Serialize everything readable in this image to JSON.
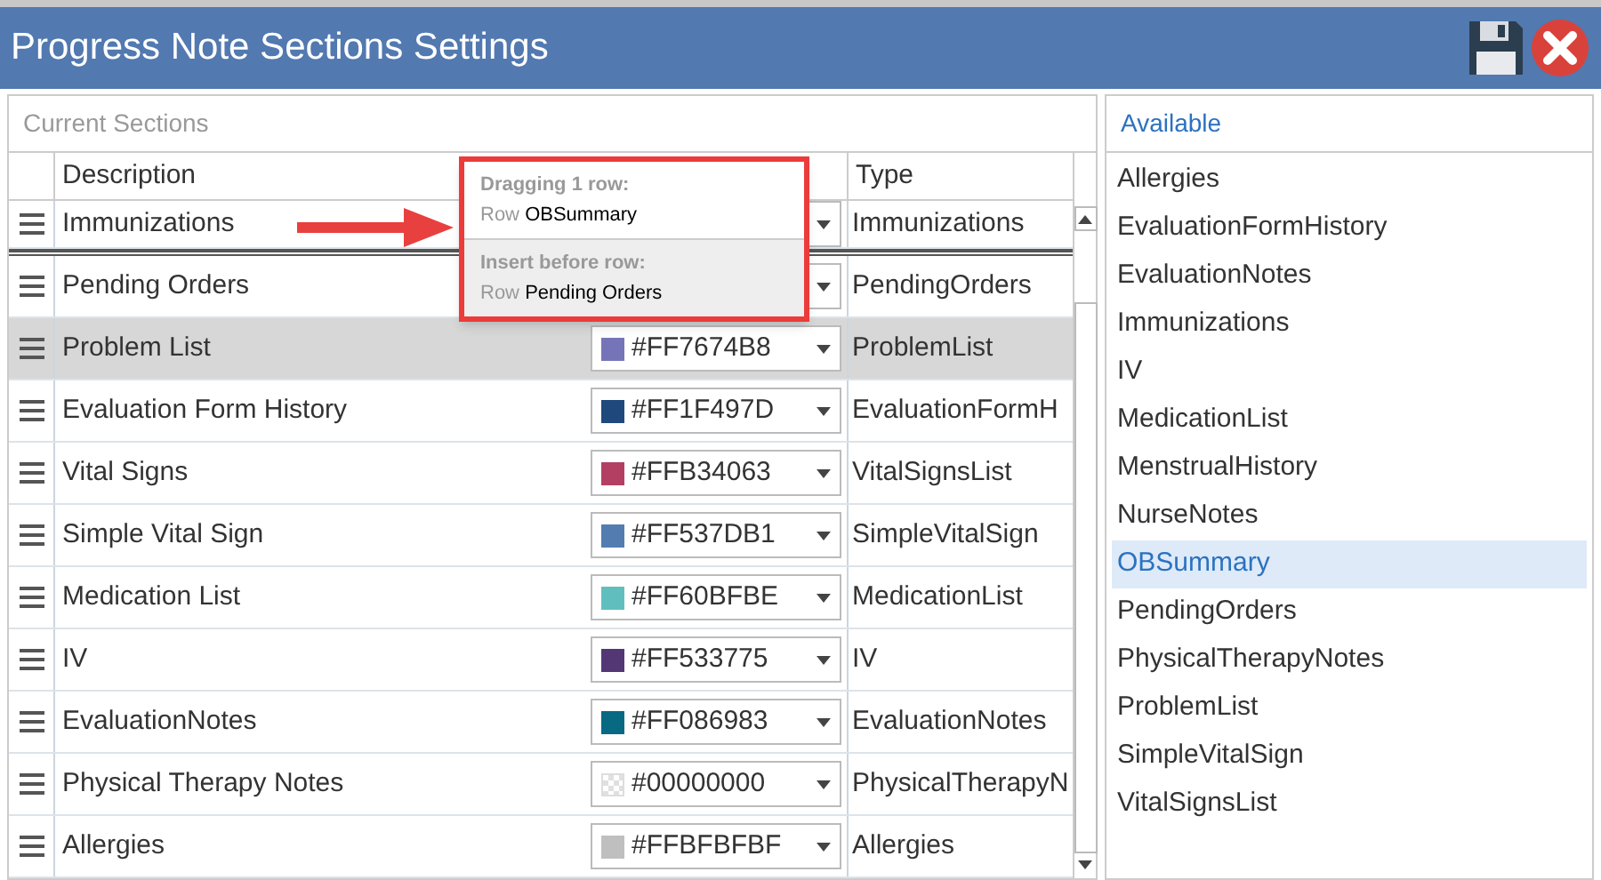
{
  "window": {
    "title": "Progress Note Sections Settings"
  },
  "current_sections": {
    "title": "Current Sections",
    "columns": [
      "Description",
      "Type"
    ],
    "rows": [
      {
        "description": "Immunizations",
        "type": "Immunizations",
        "selected": false,
        "insert_before": false,
        "color_picker": {}
      },
      {
        "description": "Pending Orders",
        "type": "PendingOrders",
        "selected": false,
        "insert_before": true,
        "color_picker": {}
      },
      {
        "description": "Problem List",
        "type": "ProblemList",
        "selected": true,
        "insert_before": false,
        "color_picker": {
          "value": "#FF7674B8",
          "kind": "solid",
          "color": "#7674b8"
        }
      },
      {
        "description": "Evaluation Form History",
        "type": "EvaluationFormH",
        "selected": false,
        "insert_before": false,
        "color_picker": {
          "value": "#FF1F497D",
          "kind": "solid",
          "color": "#1f497d"
        }
      },
      {
        "description": "Vital Signs",
        "type": "VitalSignsList",
        "selected": false,
        "insert_before": false,
        "color_picker": {
          "value": "#FFB34063",
          "kind": "solid",
          "color": "#b34063"
        }
      },
      {
        "description": "Simple Vital Sign",
        "type": "SimpleVitalSign",
        "selected": false,
        "insert_before": false,
        "color_picker": {
          "value": "#FF537DB1",
          "kind": "solid",
          "color": "#537db1"
        }
      },
      {
        "description": "Medication List",
        "type": "MedicationList",
        "selected": false,
        "insert_before": false,
        "color_picker": {
          "value": "#FF60BFBE",
          "kind": "solid",
          "color": "#60bfbe"
        }
      },
      {
        "description": "IV",
        "type": "IV",
        "selected": false,
        "insert_before": false,
        "color_picker": {
          "value": "#FF533775",
          "kind": "solid",
          "color": "#533775"
        }
      },
      {
        "description": "EvaluationNotes",
        "type": "EvaluationNotes",
        "selected": false,
        "insert_before": false,
        "color_picker": {
          "value": "#FF086983",
          "kind": "solid",
          "color": "#086983"
        }
      },
      {
        "description": "Physical Therapy Notes",
        "type": "PhysicalTherapyN",
        "selected": false,
        "insert_before": false,
        "color_picker": {
          "value": "#00000000",
          "kind": "transparent"
        }
      },
      {
        "description": "Allergies",
        "type": "Allergies",
        "selected": false,
        "insert_before": false,
        "color_picker": {
          "value": "#FFBFBFBF",
          "kind": "solid",
          "color": "#bfbfbf"
        }
      }
    ]
  },
  "drag_tooltip": {
    "dragging_label": "Dragging 1 row:",
    "dragging_prefix": "Row",
    "dragging_row": "OBSummary",
    "insert_label": "Insert before row:",
    "insert_prefix": "Row",
    "insert_row": "Pending Orders"
  },
  "available": {
    "title": "Available",
    "items": [
      {
        "label": "Allergies",
        "selected": false
      },
      {
        "label": "EvaluationFormHistory",
        "selected": false
      },
      {
        "label": "EvaluationNotes",
        "selected": false
      },
      {
        "label": "Immunizations",
        "selected": false
      },
      {
        "label": "IV",
        "selected": false
      },
      {
        "label": "MedicationList",
        "selected": false
      },
      {
        "label": "MenstrualHistory",
        "selected": false
      },
      {
        "label": "NurseNotes",
        "selected": false
      },
      {
        "label": "OBSummary",
        "selected": true
      },
      {
        "label": "PendingOrders",
        "selected": false
      },
      {
        "label": "PhysicalTherapyNotes",
        "selected": false
      },
      {
        "label": "ProblemList",
        "selected": false
      },
      {
        "label": "SimpleVitalSign",
        "selected": false
      },
      {
        "label": "VitalSignsList",
        "selected": false
      }
    ]
  }
}
